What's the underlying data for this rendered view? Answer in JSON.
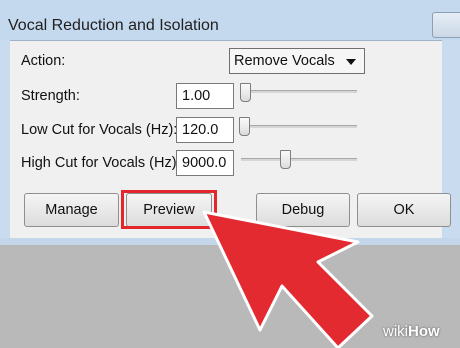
{
  "window": {
    "title": "Vocal Reduction and Isolation"
  },
  "fields": {
    "action_label": "Action:",
    "action_value": "Remove Vocals",
    "strength_label": "Strength:",
    "strength_value": "1.00",
    "low_cut_label": "Low Cut for Vocals (Hz):",
    "low_cut_value": "120.0",
    "high_cut_label": "High Cut for Vocals (Hz):",
    "high_cut_value": "9000.0"
  },
  "buttons": {
    "manage": "Manage",
    "preview": "Preview",
    "debug": "Debug",
    "ok": "OK"
  },
  "watermark": {
    "prefix": "wiki",
    "suffix": "How"
  },
  "colors": {
    "highlight": "#e2262c",
    "titlebar": "#c5d9ee"
  }
}
